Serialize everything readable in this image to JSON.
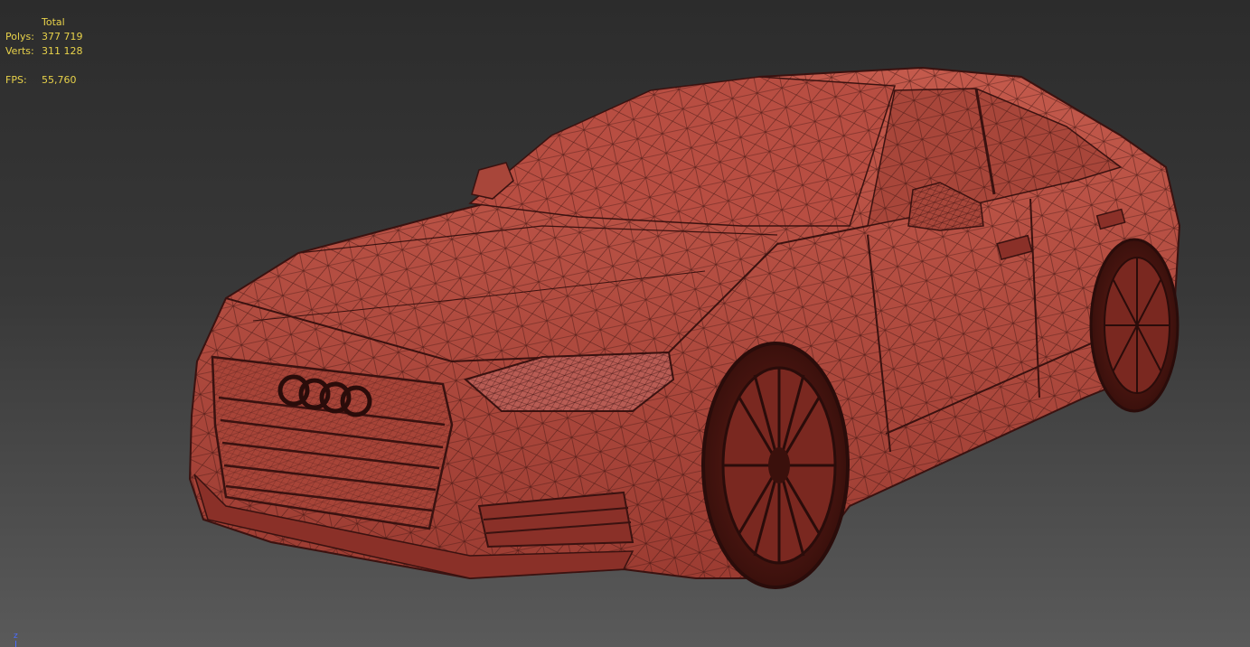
{
  "stats": {
    "header": "Total",
    "polys_label": "Polys:",
    "polys_value": "377 719",
    "verts_label": "Verts:",
    "verts_value": "311 128",
    "fps_label": "FPS:",
    "fps_value": "55,760"
  },
  "axis": {
    "label": "z"
  },
  "colors": {
    "stats_text": "#e8d24a",
    "mesh_fill": "#c0574a",
    "wire": "#3a1210",
    "axis": "#4a6cff"
  }
}
